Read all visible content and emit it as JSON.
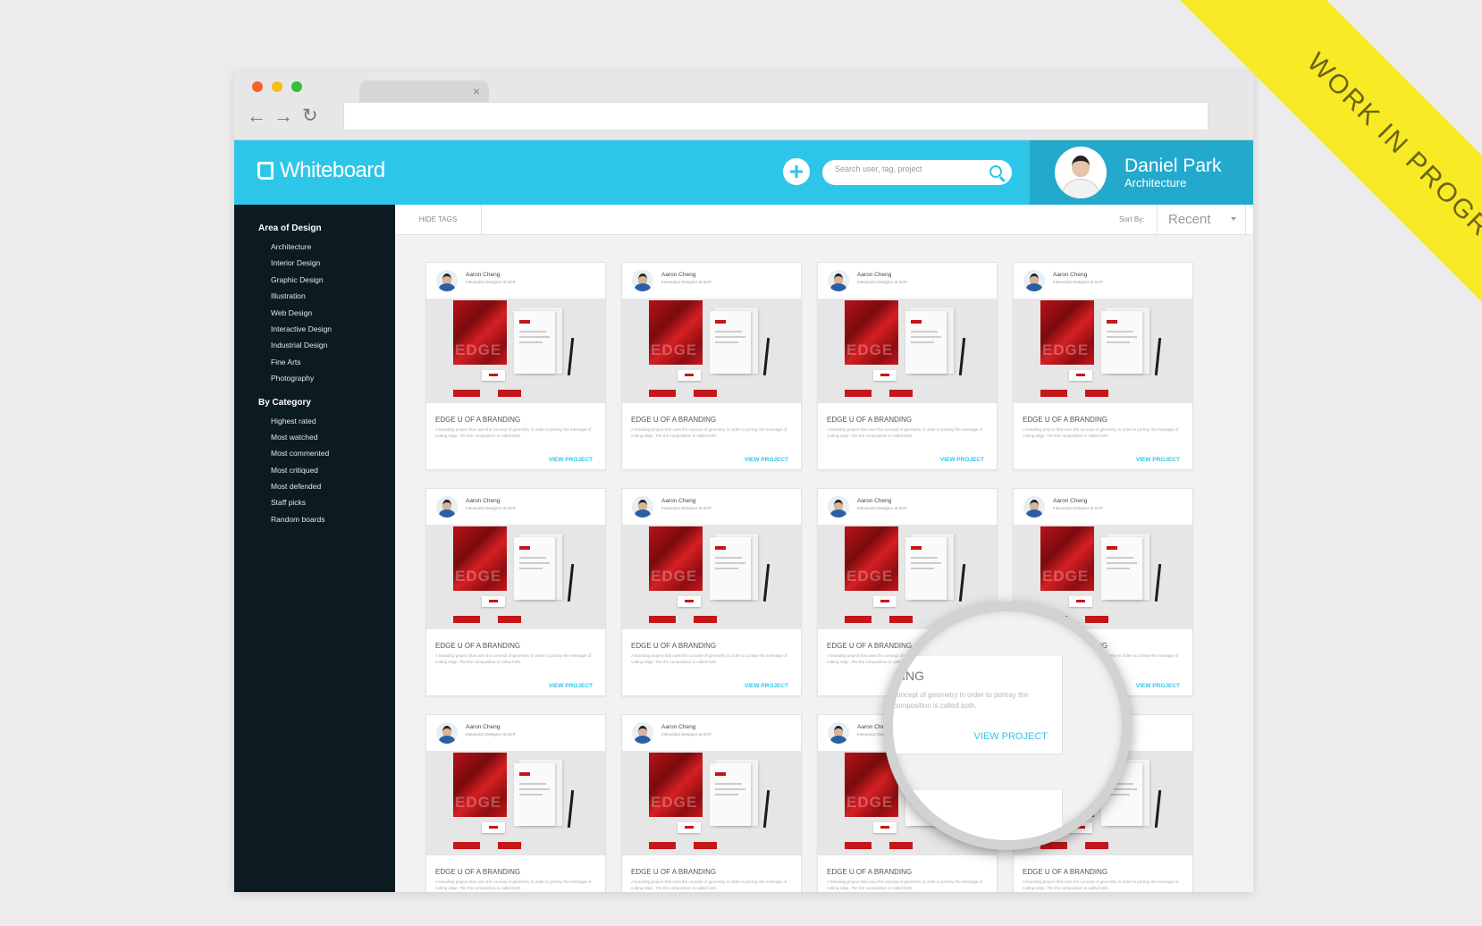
{
  "browser": {
    "tab_close": "×",
    "nav_back": "←",
    "nav_forward": "→",
    "nav_reload": "↻"
  },
  "header": {
    "logo": "Whiteboard",
    "add_label": "+",
    "search_placeholder": "Search user, tag, project",
    "user_name": "Daniel Park",
    "user_role": "Architecture",
    "accent_color": "#2ec6e8"
  },
  "sidebar": {
    "area_heading": "Area of Design",
    "area_items": [
      "Architecture",
      "Interior Design",
      "Graphic Design",
      "Illustration",
      "Web Design",
      "Interactive Design",
      "Industrial Design",
      "Fine Arts",
      "Photography"
    ],
    "category_heading": "By Category",
    "category_items": [
      "Highest rated",
      "Most watched",
      "Most commented",
      "Most critiqued",
      "Most defended",
      "Staff picks",
      "Random boards"
    ]
  },
  "toolbar": {
    "hide_tags": "HIDE TAGS",
    "sort_label": "Sort By:",
    "sort_value": "Recent"
  },
  "card": {
    "author": "Aaron Cheng",
    "role": "Interaction Designer at SCP",
    "title": "EDGE U OF A BRANDING",
    "description": "A branding project that uses the concept of geometry in order to portray the message of cutting edge. The the composition is called both.",
    "link": "VIEW PROJECT",
    "poster_text": "EDGE"
  },
  "magnifier": {
    "title": "DING",
    "description": "concept of geometry in order to portray the composition is called both.",
    "link": "VIEW PROJECT"
  },
  "ribbon": {
    "text": "WORK IN PROGRESS"
  }
}
